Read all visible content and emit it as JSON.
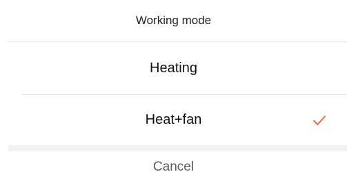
{
  "sheet": {
    "title": "Working mode",
    "options": [
      {
        "label": "Heating",
        "selected": false
      },
      {
        "label": "Heat+fan",
        "selected": true
      }
    ],
    "check_icon": "checkmark-icon",
    "cancel_label": "Cancel"
  },
  "colors": {
    "accent": "#F26A2E",
    "divider": "#E6E6E6",
    "gap": "#F2F2F2"
  }
}
